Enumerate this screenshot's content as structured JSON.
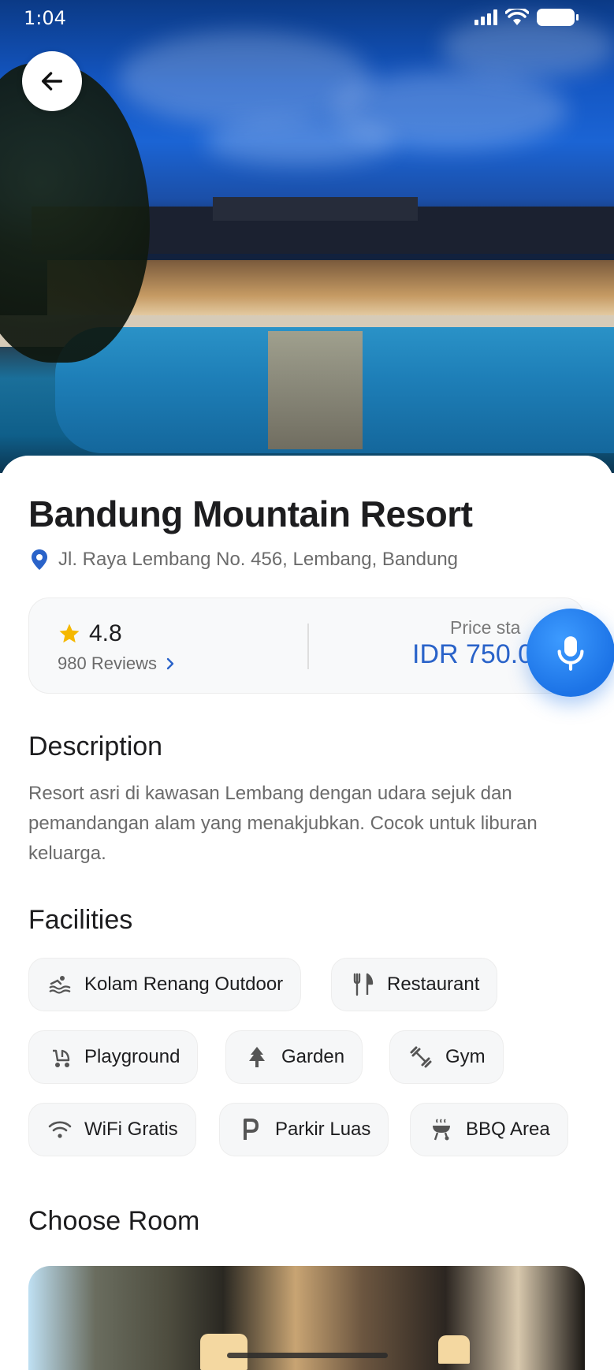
{
  "status_bar": {
    "time": "1:04"
  },
  "hotel": {
    "name": "Bandung Mountain Resort",
    "address": "Jl. Raya Lembang No. 456, Lembang, Bandung",
    "rating": "4.8",
    "reviews": "980 Reviews",
    "price_label": "Price sta",
    "price": "IDR 750.0"
  },
  "sections": {
    "description_title": "Description",
    "description_text": "Resort asri di kawasan Lembang dengan udara sejuk dan pemandangan alam yang menakjubkan. Cocok untuk liburan keluarga.",
    "facilities_title": "Facilities",
    "choose_room_title": "Choose Room"
  },
  "facilities": [
    {
      "label": "Kolam Renang Outdoor",
      "icon": "pool-icon"
    },
    {
      "label": "Restaurant",
      "icon": "restaurant-icon"
    },
    {
      "label": "Playground",
      "icon": "stroller-icon"
    },
    {
      "label": "Garden",
      "icon": "tree-icon"
    },
    {
      "label": "Gym",
      "icon": "dumbbell-icon"
    },
    {
      "label": "WiFi Gratis",
      "icon": "wifi-icon"
    },
    {
      "label": "Parkir Luas",
      "icon": "parking-icon"
    },
    {
      "label": "BBQ Area",
      "icon": "grill-icon"
    }
  ],
  "colors": {
    "accent": "#2a63c9",
    "star": "#f5b800",
    "mic": "#1c73e6",
    "pin": "#2a63c9"
  }
}
